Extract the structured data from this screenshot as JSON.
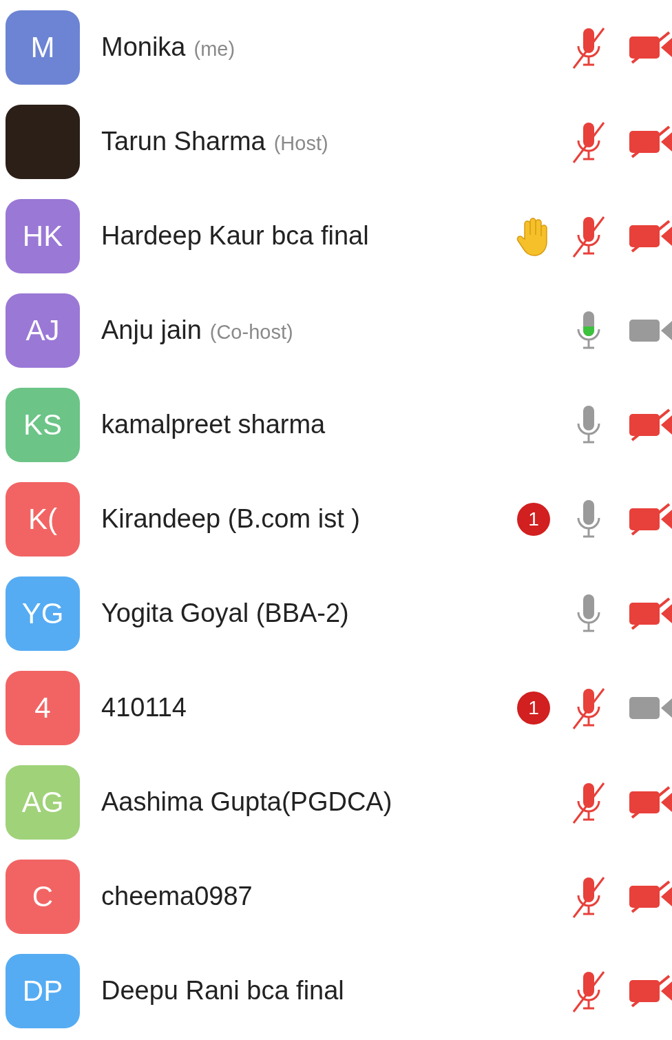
{
  "participants": [
    {
      "avatar": {
        "kind": "initials",
        "text": "M",
        "color": "#6d84d4"
      },
      "name": "Monika",
      "tag": "(me)",
      "hand_raised": false,
      "mic_muted": true,
      "speaking": false,
      "video_on": false
    },
    {
      "avatar": {
        "kind": "photo"
      },
      "name": "Tarun Sharma",
      "tag": "(Host)",
      "hand_raised": false,
      "mic_muted": true,
      "speaking": false,
      "video_on": false
    },
    {
      "avatar": {
        "kind": "initials",
        "text": "HK",
        "color": "#9a78d6"
      },
      "name": "Hardeep Kaur bca final",
      "hand_raised": true,
      "mic_muted": true,
      "speaking": false,
      "video_on": false
    },
    {
      "avatar": {
        "kind": "initials",
        "text": "AJ",
        "color": "#9a78d6"
      },
      "name": "Anju jain",
      "tag": "(Co-host)",
      "hand_raised": false,
      "mic_muted": false,
      "speaking": true,
      "video_on": true
    },
    {
      "avatar": {
        "kind": "initials",
        "text": "KS",
        "color": "#6cc487"
      },
      "name": "kamalpreet sharma",
      "hand_raised": false,
      "mic_muted": false,
      "speaking": false,
      "video_on": false
    },
    {
      "avatar": {
        "kind": "initials",
        "text": "K(",
        "color": "#f26464"
      },
      "name": "Kirandeep (B.com ist )",
      "hand_raised": false,
      "unread": "1",
      "mic_muted": false,
      "speaking": false,
      "video_on": false
    },
    {
      "avatar": {
        "kind": "initials",
        "text": "YG",
        "color": "#55acf3"
      },
      "name": "Yogita Goyal (BBA-2)",
      "hand_raised": false,
      "mic_muted": false,
      "speaking": false,
      "video_on": false
    },
    {
      "avatar": {
        "kind": "initials",
        "text": "4",
        "color": "#f26464"
      },
      "name": "410114",
      "hand_raised": false,
      "unread": "1",
      "mic_muted": true,
      "speaking": false,
      "video_on": true
    },
    {
      "avatar": {
        "kind": "initials",
        "text": "AG",
        "color": "#a0d27a"
      },
      "name": "Aashima Gupta(PGDCA)",
      "hand_raised": false,
      "mic_muted": true,
      "speaking": false,
      "video_on": false
    },
    {
      "avatar": {
        "kind": "initials",
        "text": "C",
        "color": "#f26464"
      },
      "name": "cheema0987",
      "hand_raised": false,
      "mic_muted": true,
      "speaking": false,
      "video_on": false
    },
    {
      "avatar": {
        "kind": "initials",
        "text": "DP",
        "color": "#55acf3"
      },
      "name": "Deepu Rani bca final",
      "hand_raised": false,
      "mic_muted": true,
      "speaking": false,
      "video_on": false
    }
  ]
}
